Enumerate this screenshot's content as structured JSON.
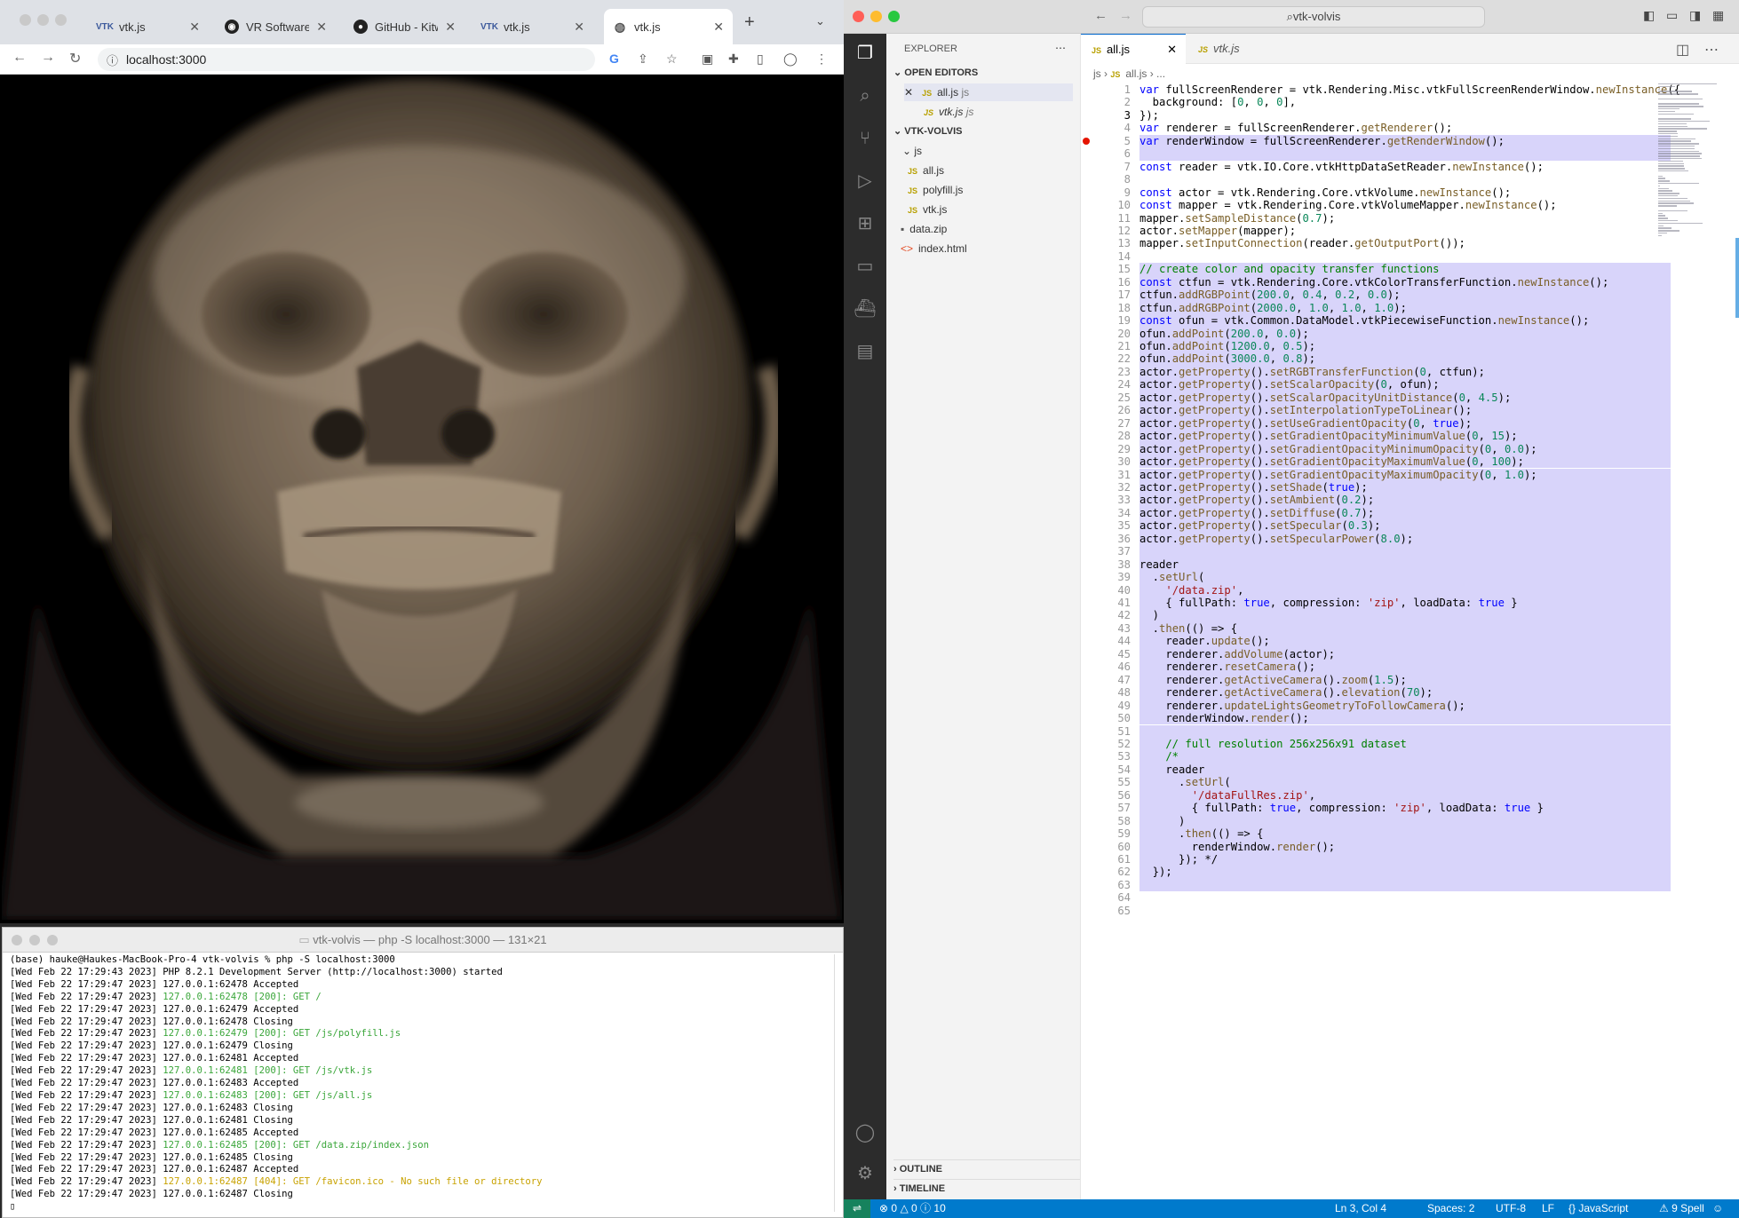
{
  "chrome": {
    "tabs": [
      {
        "title": "vtk.js",
        "icon": "vtk-logo-icon"
      },
      {
        "title": "VR Software w",
        "icon": "vr-headset-icon"
      },
      {
        "title": "GitHub - Kitw",
        "icon": "github-icon"
      },
      {
        "title": "vtk.js",
        "icon": "vtk-logo-icon"
      },
      {
        "title": "vtk.js",
        "icon": "globe-icon",
        "active": true
      }
    ],
    "url": "localhost:3000"
  },
  "terminal": {
    "title": "vtk-volvis — php -S localhost:3000 — 131×21",
    "lines": [
      {
        "text": "(base) hauke@Haukes-MacBook-Pro-4 vtk-volvis % php -S localhost:3000",
        "c": ""
      },
      {
        "p": "[Wed Feb 22 17:29:43 2023] ",
        "text": "PHP 8.2.1 Development Server (http://localhost:3000) started",
        "c": ""
      },
      {
        "p": "[Wed Feb 22 17:29:47 2023] ",
        "text": "127.0.0.1:62478 Accepted",
        "c": ""
      },
      {
        "p": "[Wed Feb 22 17:29:47 2023] ",
        "text": "127.0.0.1:62478 [200]: GET /",
        "c": "g"
      },
      {
        "p": "[Wed Feb 22 17:29:47 2023] ",
        "text": "127.0.0.1:62479 Accepted",
        "c": ""
      },
      {
        "p": "[Wed Feb 22 17:29:47 2023] ",
        "text": "127.0.0.1:62478 Closing",
        "c": ""
      },
      {
        "p": "[Wed Feb 22 17:29:47 2023] ",
        "text": "127.0.0.1:62479 [200]: GET /js/polyfill.js",
        "c": "g"
      },
      {
        "p": "[Wed Feb 22 17:29:47 2023] ",
        "text": "127.0.0.1:62479 Closing",
        "c": ""
      },
      {
        "p": "[Wed Feb 22 17:29:47 2023] ",
        "text": "127.0.0.1:62481 Accepted",
        "c": ""
      },
      {
        "p": "[Wed Feb 22 17:29:47 2023] ",
        "text": "127.0.0.1:62481 [200]: GET /js/vtk.js",
        "c": "g"
      },
      {
        "p": "[Wed Feb 22 17:29:47 2023] ",
        "text": "127.0.0.1:62483 Accepted",
        "c": ""
      },
      {
        "p": "[Wed Feb 22 17:29:47 2023] ",
        "text": "127.0.0.1:62483 [200]: GET /js/all.js",
        "c": "g"
      },
      {
        "p": "[Wed Feb 22 17:29:47 2023] ",
        "text": "127.0.0.1:62483 Closing",
        "c": ""
      },
      {
        "p": "[Wed Feb 22 17:29:47 2023] ",
        "text": "127.0.0.1:62481 Closing",
        "c": ""
      },
      {
        "p": "[Wed Feb 22 17:29:47 2023] ",
        "text": "127.0.0.1:62485 Accepted",
        "c": ""
      },
      {
        "p": "[Wed Feb 22 17:29:47 2023] ",
        "text": "127.0.0.1:62485 [200]: GET /data.zip/index.json",
        "c": "g"
      },
      {
        "p": "[Wed Feb 22 17:29:47 2023] ",
        "text": "127.0.0.1:62485 Closing",
        "c": ""
      },
      {
        "p": "[Wed Feb 22 17:29:47 2023] ",
        "text": "127.0.0.1:62487 Accepted",
        "c": ""
      },
      {
        "p": "[Wed Feb 22 17:29:47 2023] ",
        "text": "127.0.0.1:62487 [404]: GET /favicon.ico - No such file or directory",
        "c": "y"
      },
      {
        "p": "[Wed Feb 22 17:29:47 2023] ",
        "text": "127.0.0.1:62487 Closing",
        "c": ""
      }
    ]
  },
  "vscode": {
    "search": "vtk-volvis",
    "explorer_title": "EXPLORER",
    "open_editors_label": "OPEN EDITORS",
    "open_editors": [
      {
        "name": "all.js",
        "dir": "js"
      },
      {
        "name": "vtk.js",
        "dir": "js"
      }
    ],
    "project": "VTK-VOLVIS",
    "folder": "js",
    "files": [
      "all.js",
      "polyfill.js",
      "vtk.js",
      "data.zip",
      "index.html"
    ],
    "outline": "OUTLINE",
    "timeline": "TIMELINE",
    "tabs": [
      "all.js",
      "vtk.js"
    ],
    "breadcrumb": [
      "js",
      "all.js",
      "..."
    ],
    "status": {
      "problems": "0",
      "warnings": "0",
      "info": "10",
      "position": "Ln 3, Col 4",
      "spaces": "Spaces: 2",
      "encoding": "UTF-8",
      "eol": "LF",
      "language": "JavaScript",
      "spell": "9 Spell"
    },
    "code": [
      "var fullScreenRenderer = vtk.Rendering.Misc.vtkFullScreenRenderWindow.newInstance({",
      "  background: [0, 0, 0],",
      "});",
      "var renderer = fullScreenRenderer.getRenderer();",
      "var renderWindow = fullScreenRenderer.getRenderWindow();",
      "",
      "const reader = vtk.IO.Core.vtkHttpDataSetReader.newInstance();",
      "",
      "const actor = vtk.Rendering.Core.vtkVolume.newInstance();",
      "const mapper = vtk.Rendering.Core.vtkVolumeMapper.newInstance();",
      "mapper.setSampleDistance(0.7);",
      "actor.setMapper(mapper);",
      "mapper.setInputConnection(reader.getOutputPort());",
      "",
      "// create color and opacity transfer functions",
      "const ctfun = vtk.Rendering.Core.vtkColorTransferFunction.newInstance();",
      "ctfun.addRGBPoint(200.0, 0.4, 0.2, 0.0);",
      "ctfun.addRGBPoint(2000.0, 1.0, 1.0, 1.0);",
      "const ofun = vtk.Common.DataModel.vtkPiecewiseFunction.newInstance();",
      "ofun.addPoint(200.0, 0.0);",
      "ofun.addPoint(1200.0, 0.5);",
      "ofun.addPoint(3000.0, 0.8);",
      "actor.getProperty().setRGBTransferFunction(0, ctfun);",
      "actor.getProperty().setScalarOpacity(0, ofun);",
      "actor.getProperty().setScalarOpacityUnitDistance(0, 4.5);",
      "actor.getProperty().setInterpolationTypeToLinear();",
      "actor.getProperty().setUseGradientOpacity(0, true);",
      "actor.getProperty().setGradientOpacityMinimumValue(0, 15);",
      "actor.getProperty().setGradientOpacityMinimumOpacity(0, 0.0);",
      "actor.getProperty().setGradientOpacityMaximumValue(0, 100);",
      "actor.getProperty().setGradientOpacityMaximumOpacity(0, 1.0);",
      "actor.getProperty().setShade(true);",
      "actor.getProperty().setAmbient(0.2);",
      "actor.getProperty().setDiffuse(0.7);",
      "actor.getProperty().setSpecular(0.3);",
      "actor.getProperty().setSpecularPower(8.0);",
      "",
      "reader",
      "  .setUrl(",
      "    '/data.zip',",
      "    { fullPath: true, compression: 'zip', loadData: true }",
      "  )",
      "  .then(() => {",
      "    reader.update();",
      "    renderer.addVolume(actor);",
      "    renderer.resetCamera();",
      "    renderer.getActiveCamera().zoom(1.5);",
      "    renderer.getActiveCamera().elevation(70);",
      "    renderer.updateLightsGeometryToFollowCamera();",
      "    renderWindow.render();",
      "",
      "    // full resolution 256x256x91 dataset",
      "    /*",
      "    reader",
      "      .setUrl(",
      "        '/dataFullRes.zip',",
      "        { fullPath: true, compression: 'zip', loadData: true }",
      "      )",
      "      .then(() => {",
      "        renderWindow.render();",
      "      }); */",
      "  });",
      "",
      "",
      ""
    ]
  }
}
